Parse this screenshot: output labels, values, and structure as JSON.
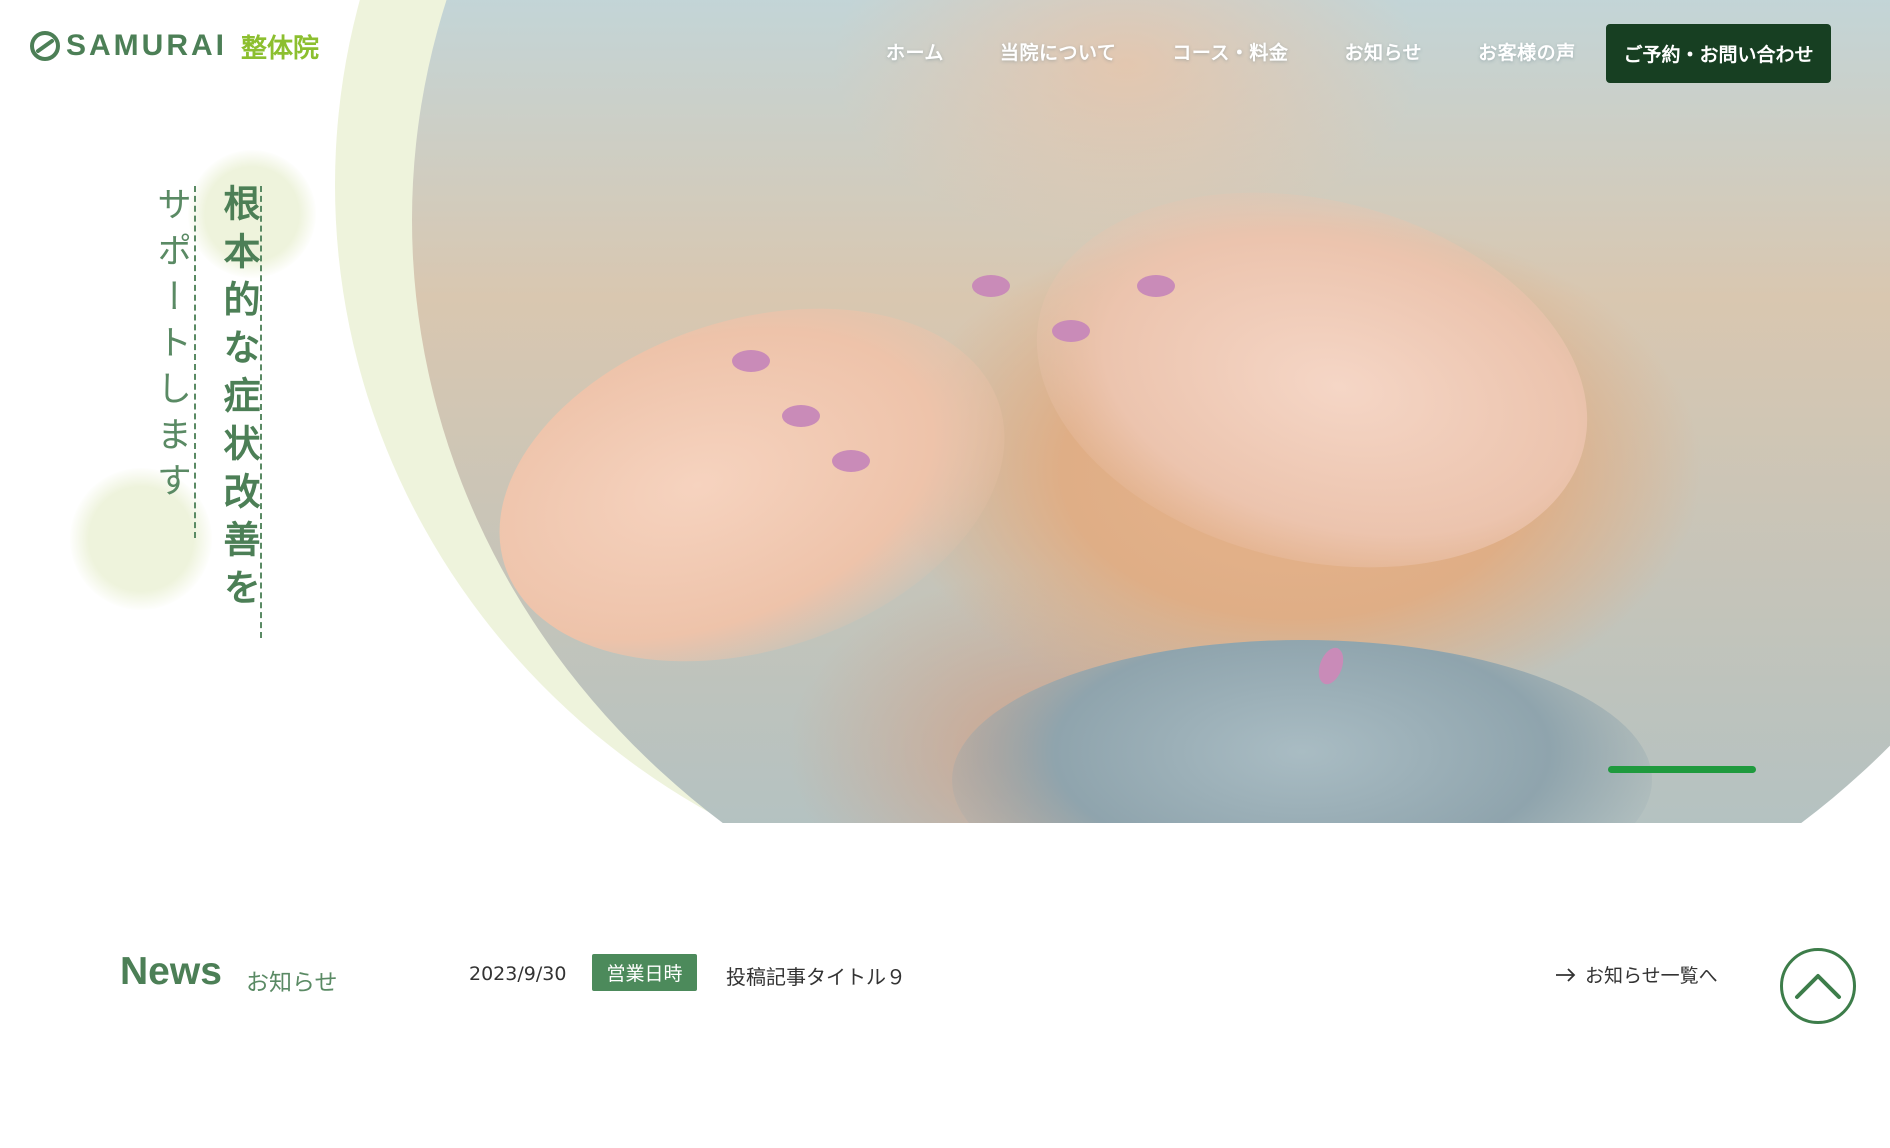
{
  "brand": {
    "name": "SAMURAI",
    "sub": "整体院",
    "color": "#4c7f56",
    "sub_color": "#8cbf2f"
  },
  "nav": {
    "items": [
      {
        "label": "ホーム"
      },
      {
        "label": "当院について"
      },
      {
        "label": "コース・料金"
      },
      {
        "label": "お知らせ"
      },
      {
        "label": "お客様の声"
      }
    ],
    "cta_label": "ご予約・お問い合わせ",
    "cta_color": "#173f22"
  },
  "hero": {
    "catch_main": "根本的な症状改善を",
    "catch_sub": "サポートします",
    "image": "massage-photo",
    "slider_active_color": "#1f9a3e"
  },
  "news": {
    "title": "News",
    "subtitle": "お知らせ",
    "latest": {
      "date": "2023/9/30",
      "category": "営業日時",
      "post_title": "投稿記事タイトル９"
    },
    "more_label": "お知らせ一覧へ"
  },
  "icons": {
    "logo": "samurai-logo-icon",
    "arrow": "arrow-right-icon",
    "pagetop": "chevron-up-icon"
  }
}
